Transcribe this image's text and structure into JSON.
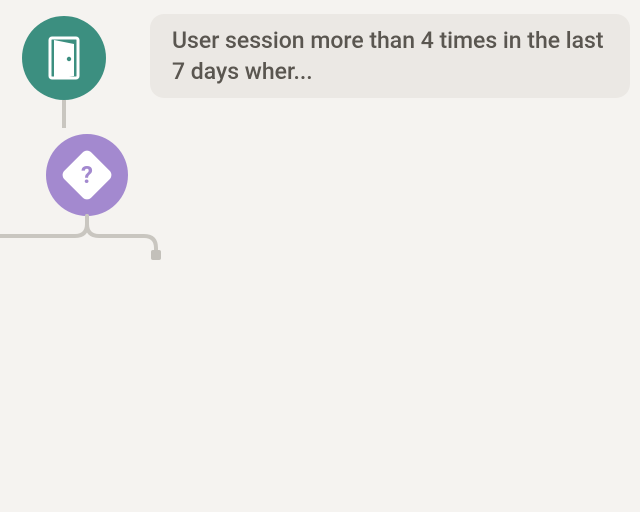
{
  "nodes": {
    "entry": {
      "icon": "door-icon",
      "color": "#3c8f80",
      "label": "User session more than 4 times in the last 7 days wher..."
    },
    "condition": {
      "icon": "question-diamond-icon",
      "glyph": "?",
      "color": "#a389cf"
    }
  },
  "colors": {
    "bg": "#f5f3f0",
    "connector": "#c9c6c0",
    "labelBg": "#ebe8e4",
    "labelText": "#5a5650"
  }
}
